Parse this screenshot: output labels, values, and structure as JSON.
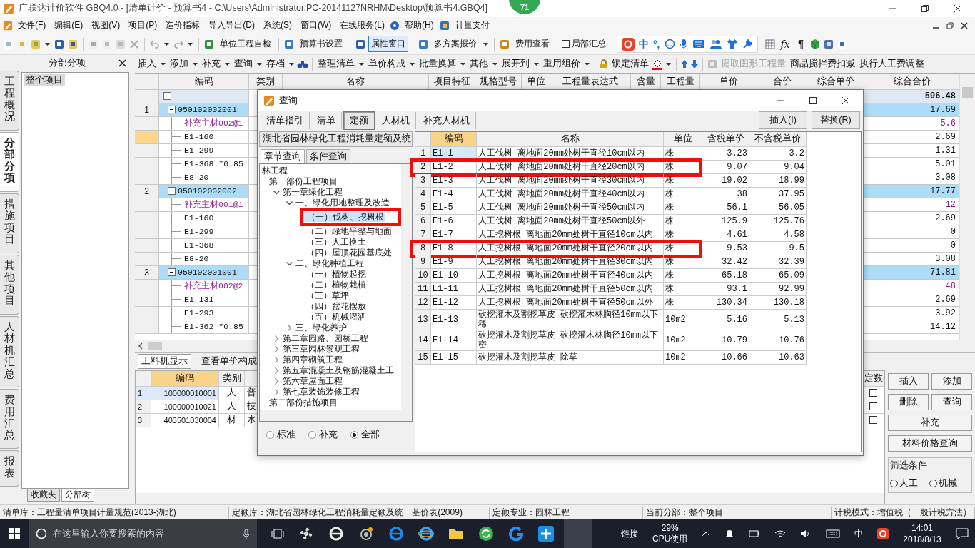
{
  "window": {
    "title": "广联达计价软件 GBQ4.0 - [清单计价 - 预算书4 - C:\\Users\\Administrator.PC-20141127NRHM\\Desktop\\预算书4.GBQ4]",
    "badge": "71"
  },
  "menu": [
    "文件(F)",
    "编辑(E)",
    "视图(V)",
    "项目(P)",
    "造价指标",
    "导入导出(D)",
    "系统(S)",
    "窗口(W)",
    "在线服务(L)",
    "帮助(H)",
    "计量支付"
  ],
  "toolbar": [
    {
      "kind": "button",
      "label": "单位工程自检",
      "pressed": false,
      "dropdown": false
    },
    {
      "kind": "button",
      "label": "预算书设置",
      "pressed": false,
      "dropdown": false
    },
    {
      "kind": "button",
      "label": "属性窗口",
      "pressed": true,
      "dropdown": false
    },
    {
      "kind": "button",
      "label": "多方案报价",
      "pressed": false,
      "dropdown": true
    },
    {
      "kind": "button",
      "label": "费用查看",
      "pressed": false,
      "dropdown": false
    },
    {
      "kind": "checkbox",
      "label": "局部汇总",
      "checked": false
    }
  ],
  "ime_bar": {
    "mode": "中",
    "punctuation": "°,"
  },
  "toolbar_glyphs": [
    "fx",
    "¶"
  ],
  "side_tabs": [
    {
      "label": "工程概况",
      "selected": false
    },
    {
      "label": "分部分项",
      "selected": true
    },
    {
      "label": "措施项目",
      "selected": false
    },
    {
      "label": "其他项目",
      "selected": false
    },
    {
      "label": "人材机汇总",
      "selected": false
    },
    {
      "label": "费用汇总",
      "selected": false
    },
    {
      "label": "报表",
      "selected": false
    }
  ],
  "left_panel": {
    "title": "分部分项",
    "items": [
      {
        "label": "整个项目",
        "selected": true
      }
    ],
    "tabs": [
      {
        "label": "收藏夹",
        "selected": false
      },
      {
        "label": "分部树",
        "selected": true
      }
    ]
  },
  "edit_toolbar": [
    {
      "label": "插入",
      "dropdown": true,
      "disabled": false
    },
    {
      "label": "添加",
      "dropdown": true,
      "disabled": false
    },
    {
      "label": "补充",
      "dropdown": true,
      "disabled": false
    },
    {
      "label": "查询",
      "dropdown": true,
      "disabled": false
    },
    {
      "label": "存档",
      "dropdown": true,
      "disabled": false
    },
    {
      "label": "整理清单",
      "dropdown": true,
      "disabled": false
    },
    {
      "label": "单价构成",
      "dropdown": true,
      "disabled": false
    },
    {
      "label": "批量换算",
      "dropdown": true,
      "disabled": false
    },
    {
      "label": "其他",
      "dropdown": true,
      "disabled": false
    },
    {
      "label": "展开到",
      "dropdown": true,
      "disabled": false
    },
    {
      "label": "重用组价",
      "dropdown": true,
      "disabled": false
    },
    {
      "label": "锁定清单",
      "dropdown": false,
      "disabled": false
    },
    {
      "label": "提取图形工程量",
      "dropdown": false,
      "disabled": true
    },
    {
      "label": "商品搅拌费扣减",
      "dropdown": false,
      "disabled": false
    },
    {
      "label": "执行人工费调整",
      "dropdown": false,
      "disabled": false
    }
  ],
  "grid": {
    "columns": [
      "编码",
      "类别",
      "名称",
      "项目特征",
      "规格型号",
      "单位",
      "工程量表达式",
      "含量",
      "工程量",
      "单价",
      "合价",
      "综合单价",
      "综合合价"
    ],
    "rows": [
      {
        "kind": "total",
        "total": "596.48",
        "selected": false
      },
      {
        "kind": "section",
        "no": "1",
        "code": "050102002001",
        "total": "17.69",
        "selected": false
      },
      {
        "kind": "material",
        "code": "补充主材002@1",
        "total": "5.6",
        "selected": false
      },
      {
        "kind": "quota",
        "code": "E1-160",
        "total": "2.69",
        "selected": true
      },
      {
        "kind": "quota",
        "code": "E1-299",
        "total": "1.31",
        "selected": false
      },
      {
        "kind": "quota",
        "code": "E1-368 *0.85",
        "total": "5.01",
        "selected": false
      },
      {
        "kind": "quota",
        "code": "E8-20",
        "total": "3.08",
        "selected": false
      },
      {
        "kind": "section",
        "no": "2",
        "code": "050102002002",
        "total": "17.77",
        "selected": false
      },
      {
        "kind": "material",
        "code": "补充主材001@1",
        "total": "12",
        "selected": false
      },
      {
        "kind": "quota",
        "code": "E1-160",
        "total": "2.69",
        "selected": false
      },
      {
        "kind": "quota",
        "code": "E1-299",
        "total": "0",
        "selected": false
      },
      {
        "kind": "quota",
        "code": "E1-368",
        "total": "0",
        "selected": false
      },
      {
        "kind": "quota",
        "code": "E8-20",
        "total": "3.08",
        "selected": false
      },
      {
        "kind": "section",
        "no": "3",
        "code": "050102001001",
        "total": "71.81",
        "selected": false
      },
      {
        "kind": "material",
        "code": "补充主材002@2",
        "total": "48",
        "selected": false
      },
      {
        "kind": "quota",
        "code": "E1-131",
        "total": "2.69",
        "selected": false
      },
      {
        "kind": "quota",
        "code": "E1-293",
        "total": "3.92",
        "selected": false
      },
      {
        "kind": "quota",
        "code": "E1-362 *0.85",
        "total": "14.12",
        "selected": false
      }
    ]
  },
  "bottom": {
    "tabs": [
      {
        "label": "工料机显示",
        "selected": true
      },
      {
        "label": "查看单价构成",
        "selected": false
      }
    ],
    "columns": [
      "编码",
      "类别"
    ],
    "last_column": "定数",
    "rows": [
      {
        "no": "1",
        "code": "100000010001",
        "type": "人",
        "column_3": "普",
        "selected": true,
        "checked": false
      },
      {
        "no": "2",
        "code": "100000010021",
        "type": "人",
        "column_3": "技",
        "selected": false,
        "checked": false
      },
      {
        "no": "3",
        "code": "403501030004",
        "type": "材",
        "column_3": "水",
        "selected": false,
        "checked": false
      }
    ],
    "buttons": [
      "插入",
      "添加",
      "删除",
      "查询",
      "补充",
      "材料价格查询"
    ],
    "filter": {
      "title": "筛选条件",
      "options": [
        {
          "label": "人工",
          "selected": false
        },
        {
          "label": "机械",
          "selected": false
        }
      ]
    }
  },
  "dialog": {
    "title": "查询",
    "tabs": [
      {
        "label": "清单指引",
        "selected": false
      },
      {
        "label": "清单",
        "selected": false
      },
      {
        "label": "定额",
        "selected": true
      },
      {
        "label": "人材机",
        "selected": false
      },
      {
        "label": "补充人材机",
        "selected": false
      }
    ],
    "actions": [
      "插入(I)",
      "替换(R)"
    ],
    "library": "湖北省园林绿化工程消耗量定额及统",
    "search_tabs": [
      {
        "label": "章节查询",
        "selected": true
      },
      {
        "label": "条件查询",
        "selected": false
      }
    ],
    "tree": [
      {
        "label": "林工程",
        "selected": false,
        "highlighted": false,
        "children": [
          {
            "label": "第一部份工程项目",
            "selected": false,
            "highlighted": false,
            "children": [
              {
                "label": "第一章绿化工程",
                "expanded": true,
                "selected": false,
                "highlighted": false,
                "children": [
                  {
                    "label": "一、绿化用地整理及改造",
                    "expanded": true,
                    "selected": false,
                    "highlighted": false,
                    "children": [
                      {
                        "label": "（一）伐树、挖树根",
                        "selected": true,
                        "highlighted": true
                      },
                      {
                        "label": "（二）绿地平整与地面",
                        "selected": false,
                        "highlighted": false
                      },
                      {
                        "label": "（三）人工换土",
                        "selected": false,
                        "highlighted": false
                      },
                      {
                        "label": "（四）屋顶花园基底处",
                        "selected": false,
                        "highlighted": false
                      }
                    ]
                  },
                  {
                    "label": "二、绿化种植工程",
                    "expanded": true,
                    "selected": false,
                    "highlighted": false,
                    "children": [
                      {
                        "label": "（一）植物起挖",
                        "selected": false,
                        "highlighted": false
                      },
                      {
                        "label": "（二）植物栽植",
                        "selected": false,
                        "highlighted": false
                      },
                      {
                        "label": "（三）草坪",
                        "selected": false,
                        "highlighted": false
                      },
                      {
                        "label": "（四）盆花摆放",
                        "selected": false,
                        "highlighted": false
                      },
                      {
                        "label": "（五）机械灌洒",
                        "selected": false,
                        "highlighted": false
                      }
                    ]
                  },
                  {
                    "label": "三、绿化养护",
                    "expanded": false,
                    "selected": false,
                    "highlighted": false
                  }
                ]
              },
              {
                "label": "第二章园路、园桥工程",
                "expanded": false,
                "selected": false,
                "highlighted": false
              },
              {
                "label": "第三章园林景观工程",
                "expanded": false,
                "selected": false,
                "highlighted": false
              },
              {
                "label": "第四章砌筑工程",
                "expanded": false,
                "selected": false,
                "highlighted": false
              },
              {
                "label": "第五章混凝土及钢筋混凝土工",
                "expanded": false,
                "selected": false,
                "highlighted": false
              },
              {
                "label": "第六章屋面工程",
                "expanded": false,
                "selected": false,
                "highlighted": false
              },
              {
                "label": "第七章装饰装修工程",
                "expanded": false,
                "selected": false,
                "highlighted": false
              }
            ]
          },
          {
            "label": "第二部份措施项目",
            "selected": false,
            "highlighted": false
          }
        ]
      }
    ],
    "filters": [
      {
        "label": "标准",
        "selected": false
      },
      {
        "label": "补充",
        "selected": false
      },
      {
        "label": "全部",
        "selected": true
      }
    ],
    "table": {
      "columns": [
        "编码",
        "名称",
        "单位",
        "含税单价",
        "不含税单价"
      ],
      "rows": [
        {
          "no": "1",
          "code": "E1-1",
          "name": "人工伐树 离地面20mm处树干直径10cm以内",
          "unit": "株",
          "price_with_tax": "3.23",
          "price_without_tax": "3.2",
          "selected": true,
          "highlighted": false
        },
        {
          "no": "2",
          "code": "E1-2",
          "name": "人工伐树 离地面20mm处树干直径20cm以内",
          "unit": "株",
          "price_with_tax": "9.07",
          "price_without_tax": "9.04",
          "selected": false,
          "highlighted": true
        },
        {
          "no": "3",
          "code": "E1-3",
          "name": "人工伐树 离地面20mm处树干直径30cm以内",
          "unit": "株",
          "price_with_tax": "19.02",
          "price_without_tax": "18.99",
          "selected": false,
          "highlighted": false
        },
        {
          "no": "4",
          "code": "E1-4",
          "name": "人工伐树 离地面20mm处树干直径40cm以内",
          "unit": "株",
          "price_with_tax": "38",
          "price_without_tax": "37.95",
          "selected": false,
          "highlighted": false
        },
        {
          "no": "5",
          "code": "E1-5",
          "name": "人工伐树 离地面20mm处树干直径50cm以内",
          "unit": "株",
          "price_with_tax": "56.1",
          "price_without_tax": "56.05",
          "selected": false,
          "highlighted": false
        },
        {
          "no": "6",
          "code": "E1-6",
          "name": "人工伐树 离地面20mm处树干直径50cm以外",
          "unit": "株",
          "price_with_tax": "125.9",
          "price_without_tax": "125.76",
          "selected": false,
          "highlighted": false
        },
        {
          "no": "7",
          "code": "E1-7",
          "name": "人工挖树根 离地面20mm处树干直径10cm以内",
          "unit": "株",
          "price_with_tax": "4.61",
          "price_without_tax": "4.58",
          "selected": false,
          "highlighted": false
        },
        {
          "no": "8",
          "code": "E1-8",
          "name": "人工挖树根 离地面20mm处树干直径20cm以内",
          "unit": "株",
          "price_with_tax": "9.53",
          "price_without_tax": "9.5",
          "selected": false,
          "highlighted": true
        },
        {
          "no": "9",
          "code": "E1-9",
          "name": "人工挖树根 离地面20mm处树干直径30cm以内",
          "unit": "株",
          "price_with_tax": "32.42",
          "price_without_tax": "32.39",
          "selected": false,
          "highlighted": false
        },
        {
          "no": "10",
          "code": "E1-10",
          "name": "人工挖树根 离地面20mm处树干直径40cm以内",
          "unit": "株",
          "price_with_tax": "65.18",
          "price_without_tax": "65.09",
          "selected": false,
          "highlighted": false
        },
        {
          "no": "11",
          "code": "E1-11",
          "name": "人工挖树根 离地面20mm处树干直径50cm以内",
          "unit": "株",
          "price_with_tax": "93.1",
          "price_without_tax": "92.99",
          "selected": false,
          "highlighted": false
        },
        {
          "no": "12",
          "code": "E1-12",
          "name": "人工挖树根 离地面20mm处树干直径50cm以外",
          "unit": "株",
          "price_with_tax": "130.34",
          "price_without_tax": "130.18",
          "selected": false,
          "highlighted": false
        },
        {
          "no": "13",
          "code": "E1-13",
          "name": "砍挖灌木及割挖草皮 砍挖灌木林胸径10mm以下稀",
          "unit": "10m2",
          "price_with_tax": "5.16",
          "price_without_tax": "5.13",
          "selected": false,
          "highlighted": false
        },
        {
          "no": "14",
          "code": "E1-14",
          "name": "砍挖灌木及割挖草皮 砍挖灌木林胸径10mm以下密",
          "unit": "10m2",
          "price_with_tax": "10.79",
          "price_without_tax": "10.76",
          "selected": false,
          "highlighted": false
        },
        {
          "no": "15",
          "code": "E1-15",
          "name": "砍挖灌木及割挖草皮 除草",
          "unit": "10m2",
          "price_with_tax": "10.66",
          "price_without_tax": "10.63",
          "selected": false,
          "highlighted": false
        }
      ]
    }
  },
  "status_bar": [
    "清单库：工程量清单项目计量规范(2013-湖北)",
    "定额库：湖北省园林绿化工程消耗量定额及统一基价表(2009)",
    "定额专业：园林工程",
    "当前分部：整个项目",
    "计税模式：增值税（一般计税方法）"
  ],
  "taskbar": {
    "search_placeholder": "在这里输入你要搜索的内容",
    "link": "链接",
    "cpu_value": "29%",
    "cpu_label": "CPU使用",
    "ime": "中",
    "time": "14:01",
    "date": "2018/8/13"
  }
}
